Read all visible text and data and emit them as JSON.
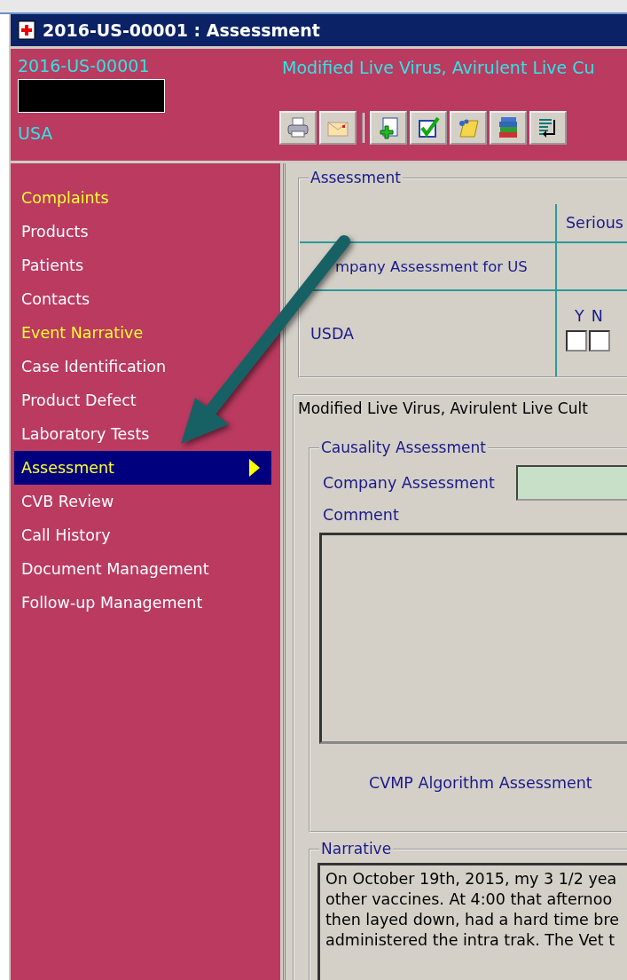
{
  "window": {
    "title": "2016-US-00001 : Assessment"
  },
  "header": {
    "case_id": "2016-US-00001",
    "country": "USA",
    "product": "Modified Live Virus, Avirulent Live Cu"
  },
  "toolbar": [
    {
      "kind": "printer"
    },
    {
      "kind": "envelope"
    },
    {
      "kind": "add"
    },
    {
      "kind": "check"
    },
    {
      "kind": "note"
    },
    {
      "kind": "books"
    },
    {
      "kind": "return"
    }
  ],
  "sidebar": {
    "items": [
      {
        "label": "Complaints",
        "highlighted": true,
        "selected": false
      },
      {
        "label": "Products",
        "highlighted": false,
        "selected": false
      },
      {
        "label": "Patients",
        "highlighted": false,
        "selected": false
      },
      {
        "label": "Contacts",
        "highlighted": false,
        "selected": false
      },
      {
        "label": "Event Narrative",
        "highlighted": true,
        "selected": false
      },
      {
        "label": "Case Identification",
        "highlighted": false,
        "selected": false
      },
      {
        "label": "Product Defect",
        "highlighted": false,
        "selected": false
      },
      {
        "label": "Laboratory Tests",
        "highlighted": false,
        "selected": false
      },
      {
        "label": "Assessment",
        "highlighted": false,
        "selected": true
      },
      {
        "label": "CVB Review",
        "highlighted": false,
        "selected": false
      },
      {
        "label": "Call History",
        "highlighted": false,
        "selected": false
      },
      {
        "label": "Document Management",
        "highlighted": false,
        "selected": false
      },
      {
        "label": "Follow-up Management",
        "highlighted": false,
        "selected": false
      }
    ]
  },
  "assessment": {
    "title": "Assessment",
    "column_header": "Serious",
    "rows": [
      {
        "label": "mpany Assessment for US",
        "kind": "plain"
      },
      {
        "label": "USDA",
        "kind": "yesno",
        "yes_label": "Y",
        "no_label": "N",
        "yes": false,
        "no": false
      }
    ]
  },
  "product_line": "Modified Live Virus, Avirulent Live Cult",
  "causality": {
    "title": "Causality Assessment",
    "company_label": "Company Assessment",
    "comment_label": "Comment",
    "algorithm_link": "CVMP Algorithm Assessment"
  },
  "narrative": {
    "title": "Narrative",
    "lines": [
      "On October 19th, 2015, my 3 1/2 yea",
      "other vaccines. At 4:00 that afternoo",
      "then layed down, had a hard time bre",
      "administered the intra trak. The Vet t"
    ]
  }
}
